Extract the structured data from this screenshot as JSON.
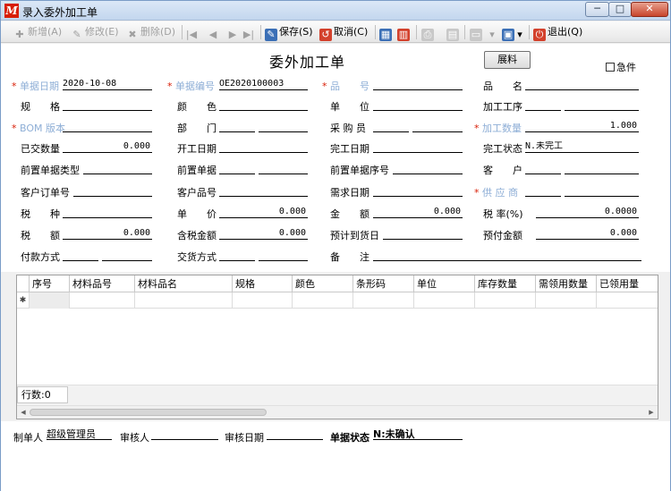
{
  "window": {
    "title": "录入委外加工单",
    "min": "─",
    "max": "□",
    "close": "✕"
  },
  "toolbar": [
    {
      "label": "新增(A)",
      "icon": "✚",
      "disabled": true
    },
    {
      "label": "修改(E)",
      "icon": "✎",
      "disabled": true
    },
    {
      "label": "删除(D)",
      "icon": "✖",
      "disabled": true
    },
    {
      "label": "",
      "icon": "|◀",
      "disabled": true
    },
    {
      "label": "",
      "icon": "◀",
      "disabled": true
    },
    {
      "label": "",
      "icon": "▶",
      "disabled": true
    },
    {
      "label": "",
      "icon": "▶|",
      "disabled": true
    },
    {
      "label": "保存(S)",
      "icon": "✎",
      "disabled": false
    },
    {
      "label": "取消(C)",
      "icon": "↺",
      "disabled": false
    },
    {
      "label": "",
      "icon": "▦",
      "disabled": false
    },
    {
      "label": "",
      "icon": "▥",
      "disabled": false
    },
    {
      "label": "",
      "icon": "⎙",
      "disabled": true
    },
    {
      "label": "",
      "icon": "▤",
      "disabled": true
    },
    {
      "label": "",
      "icon": "▭",
      "disabled": true
    },
    {
      "label": "",
      "icon": "▾",
      "disabled": false
    },
    {
      "label": "",
      "icon": "▣",
      "disabled": false
    },
    {
      "label": "退出(Q)",
      "icon": "⏻",
      "disabled": false
    }
  ],
  "form": {
    "title": "委外加工单",
    "print_label": "展料",
    "urgent_label": "急件",
    "fields": {
      "doc_date": {
        "label": "单据日期",
        "value": "2020-10-08"
      },
      "doc_no": {
        "label": "单据编号",
        "value": "OE2020100003"
      },
      "item_no": {
        "label": "品　　号",
        "value": ""
      },
      "item_name": {
        "label": "品　　名",
        "value": ""
      },
      "spec": {
        "label": "规　　格",
        "value": ""
      },
      "color": {
        "label": "颜　　色",
        "value": ""
      },
      "unit": {
        "label": "单　　位",
        "value": ""
      },
      "process": {
        "label": "加工工序",
        "value": ""
      },
      "bom": {
        "label": "BOM 版本",
        "value": ""
      },
      "dept": {
        "label": "部　　门",
        "value": ""
      },
      "buyer": {
        "label": "采 购 员",
        "value": ""
      },
      "qty": {
        "label": "加工数量",
        "value": "1.000"
      },
      "delivered_qty": {
        "label": "已交数量",
        "value": "0.000"
      },
      "start_date": {
        "label": "开工日期",
        "value": ""
      },
      "finish_date": {
        "label": "完工日期",
        "value": ""
      },
      "finish_status": {
        "label": "完工状态",
        "value": "N.未完工"
      },
      "pre_doc_type": {
        "label": "前置单据类型",
        "value": ""
      },
      "pre_doc": {
        "label": "前置单据",
        "value": ""
      },
      "pre_doc_seq": {
        "label": "前置单据序号",
        "value": ""
      },
      "customer": {
        "label": "客　　户",
        "value": ""
      },
      "cust_order": {
        "label": "客户订单号",
        "value": ""
      },
      "cust_item": {
        "label": "客户品号",
        "value": ""
      },
      "need_date": {
        "label": "需求日期",
        "value": ""
      },
      "supplier": {
        "label": "供 应 商",
        "value": ""
      },
      "tax_type": {
        "label": "税　　种",
        "value": ""
      },
      "price": {
        "label": "单　　价",
        "value": "0.000"
      },
      "amount": {
        "label": "金　　额",
        "value": "0.000"
      },
      "tax_rate": {
        "label": "税 率(%)",
        "value": "0.0000"
      },
      "tax": {
        "label": "税　　额",
        "value": "0.000"
      },
      "tax_incl": {
        "label": "含税金额",
        "value": "0.000"
      },
      "arrival_date": {
        "label": "预计到货日",
        "value": ""
      },
      "prepay": {
        "label": "预付金额",
        "value": "0.000"
      },
      "pay_method": {
        "label": "付款方式",
        "value": ""
      },
      "ship_method": {
        "label": "交货方式",
        "value": ""
      },
      "remark": {
        "label": "备　　注",
        "value": ""
      }
    }
  },
  "grid": {
    "columns": [
      "序号",
      "材料品号",
      "材料品名",
      "规格",
      "颜色",
      "条形码",
      "单位",
      "库存数量",
      "需领用数量",
      "已领用量"
    ],
    "new_row_marker": "✱",
    "row_count": "行数:0"
  },
  "footer": {
    "maker_label": "制单人",
    "maker": "超级管理员",
    "auditor_label": "审核人",
    "auditor": "",
    "audit_date_label": "审核日期",
    "audit_date": "",
    "status_label": "单据状态",
    "status": "N:未确认"
  }
}
